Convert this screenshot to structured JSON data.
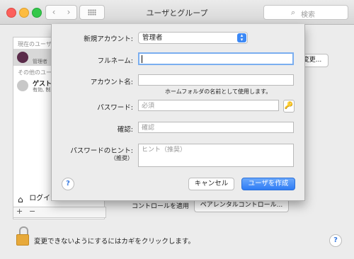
{
  "window": {
    "title": "ユーザとグループ"
  },
  "toolbar": {
    "back": "‹",
    "forward": "›",
    "search_placeholder": "検索",
    "search_icon": "magnifier-icon"
  },
  "sidebar": {
    "current_users_header": "現在のユーザ",
    "current_user": {
      "role": "管理者"
    },
    "other_users_header": "その他のユーザ",
    "guest": {
      "name": "ゲスト",
      "status": "有効, 制"
    },
    "login_options_label": "ログイ",
    "add_label": "+",
    "remove_label": "−"
  },
  "background": {
    "change_button": "変更...",
    "controls_label": "コントロールを適用",
    "parental_button": "ペアレンタルコントロール...",
    "lock_message": "変更できないようにするにはカギをクリックします。",
    "help": "?"
  },
  "sheet": {
    "new_account_label": "新規アカウント:",
    "new_account_value": "管理者",
    "fullname_label": "フルネーム:",
    "fullname_value": "",
    "account_name_label": "アカウント名:",
    "account_name_value": "",
    "home_folder_hint": "ホームフォルダの名前として使用します。",
    "password_label": "パスワード:",
    "password_placeholder": "必須",
    "confirm_label": "確認:",
    "confirm_placeholder": "確認",
    "hint_label": "パスワードのヒント:",
    "hint_sublabel": "（推奨）",
    "hint_placeholder": "ヒント（推奨）",
    "cancel_button": "キャンセル",
    "create_button": "ユーザを作成",
    "help": "?"
  },
  "colors": {
    "accent": "#3d89f5",
    "lock": "#e7a93a"
  }
}
